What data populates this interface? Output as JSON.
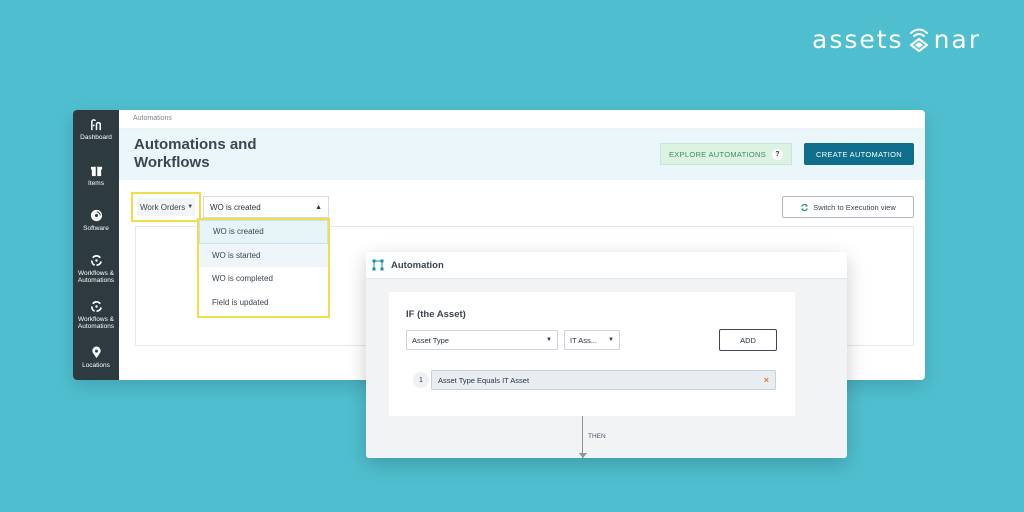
{
  "brand": {
    "text_before": "assets",
    "text_after": "nar",
    "logo_icon": "wifi-diamond-icon"
  },
  "app": {
    "breadcrumb": "Automations",
    "page_title": "Automations and Workflows",
    "explore_button": "EXPLORE AUTOMATIONS",
    "explore_help": "?",
    "create_button": "CREATE AUTOMATION",
    "switch_button": "Switch to Execution view"
  },
  "sidebar": {
    "items": [
      {
        "label": "Dashboard",
        "icon": "dashboard-icon"
      },
      {
        "label": "Items",
        "icon": "gift-box-icon"
      },
      {
        "label": "Software",
        "icon": "software-disc-icon"
      },
      {
        "label": "Workflows & Automations",
        "icon": "workflow-cycle-icon"
      },
      {
        "label": "Workflows & Automations",
        "icon": "workflow-cycle-icon"
      },
      {
        "label": "Locations",
        "icon": "location-pin-icon"
      }
    ]
  },
  "filters": {
    "entity_select": "Work Orders",
    "trigger_select": "WO is created",
    "trigger_options": [
      "WO is created",
      "WO is started",
      "WO is completed",
      "Field is updated"
    ]
  },
  "automation_card": {
    "title": "Automation",
    "if_title": "IF (the Asset)",
    "field_select": "Asset Type",
    "value_select": "IT Ass...",
    "add_button": "ADD",
    "condition_number": "1",
    "condition_text": "Asset Type Equals IT Asset",
    "remove_symbol": "×",
    "then_label": "THEN"
  },
  "colors": {
    "background": "#4fbfcf",
    "sidebar": "#2d3a40",
    "primary_button": "#0e6e8c",
    "highlight": "#f1dd4c",
    "explore_button_bg": "#dcf2e3"
  }
}
